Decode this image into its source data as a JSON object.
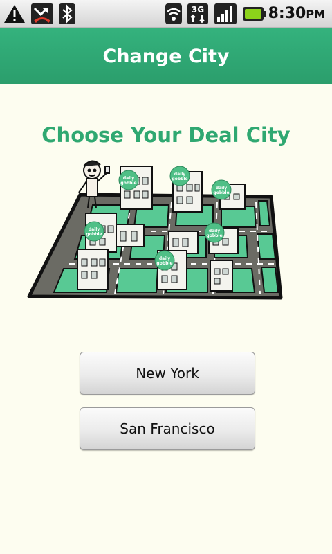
{
  "status_bar": {
    "time_main": "8:30",
    "time_suffix": "PM",
    "network": "3G",
    "icons": [
      "warning-icon",
      "missed-call-icon",
      "bluetooth-icon",
      "wifi-icon",
      "3g-data-icon",
      "signal-icon",
      "battery-icon"
    ]
  },
  "header": {
    "title": "Change City"
  },
  "main": {
    "heading": "Choose Your Deal City",
    "illustration": {
      "badge_text_line1": "daily",
      "badge_text_line2": "gobble"
    },
    "cities": [
      {
        "label": "New York"
      },
      {
        "label": "San Francisco"
      }
    ]
  },
  "colors": {
    "accent": "#2fa871",
    "title_bar": "#2ea673",
    "background": "#fdfdf0"
  }
}
